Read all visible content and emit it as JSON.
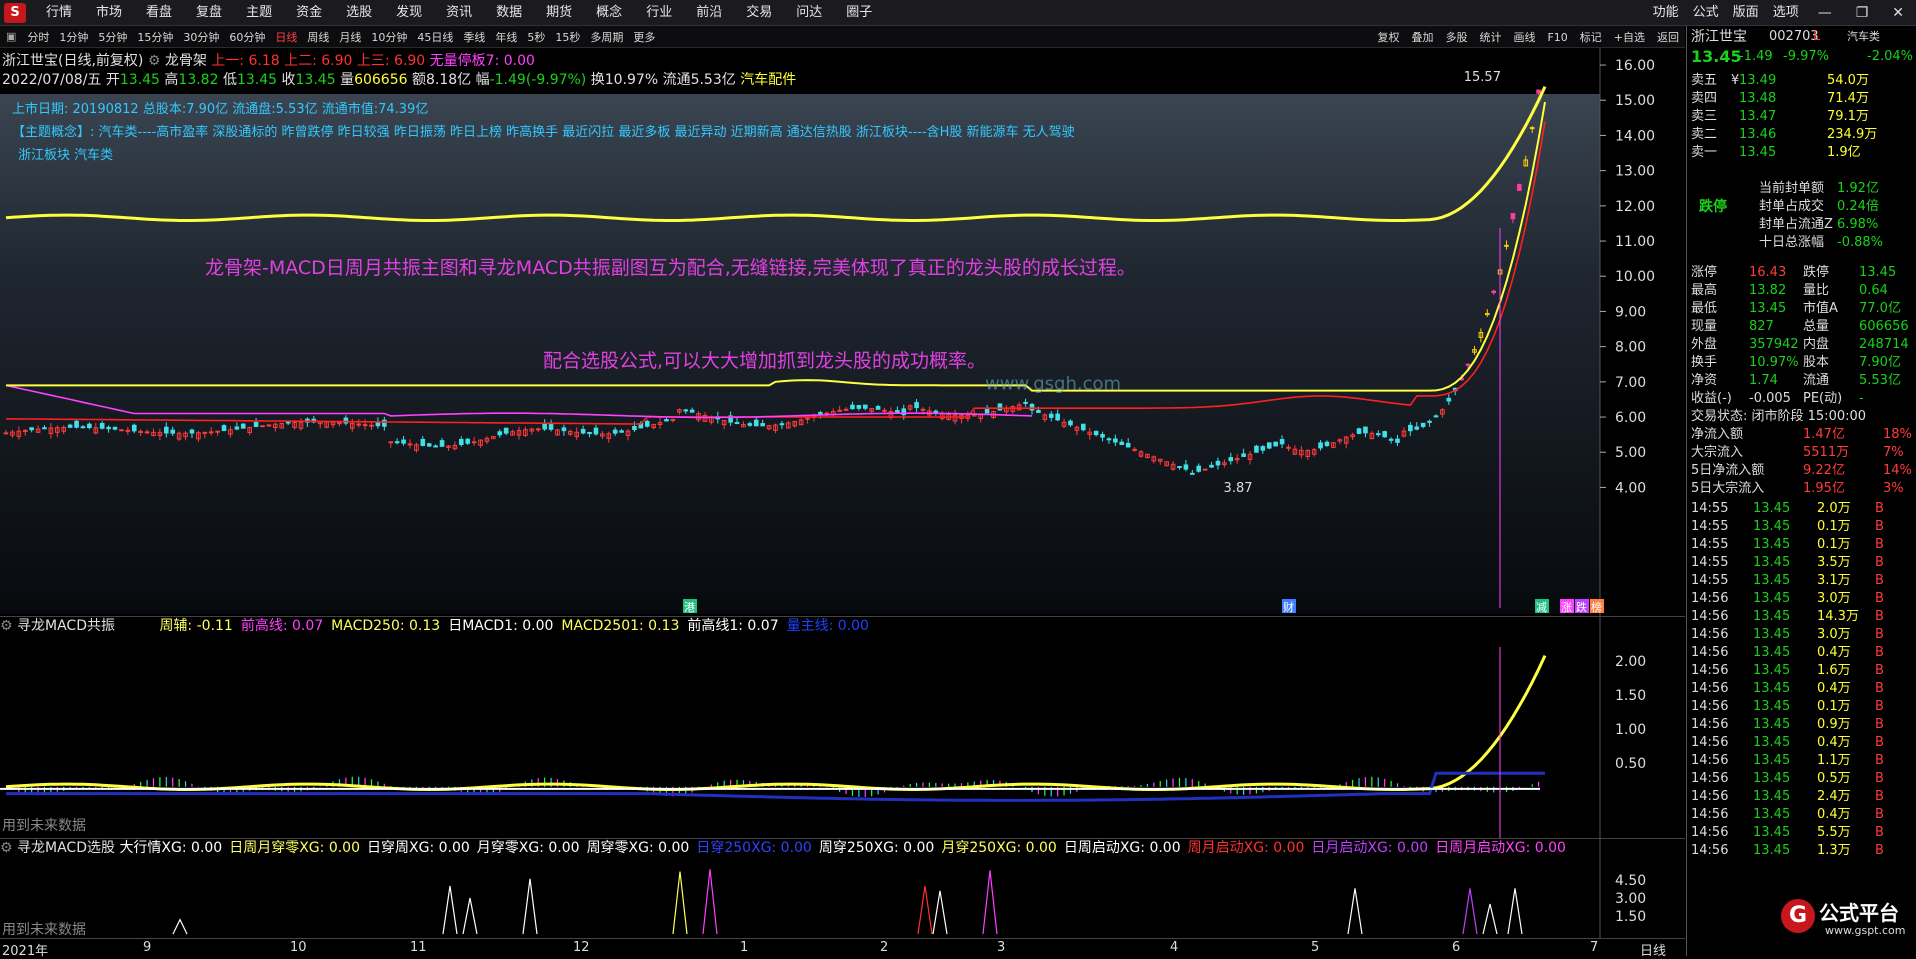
{
  "menu": {
    "logo": "S",
    "items": [
      "行情",
      "市场",
      "看盘",
      "复盘",
      "主题",
      "资金",
      "选股",
      "发现",
      "资讯",
      "数据",
      "期货",
      "概念",
      "行业",
      "前沿",
      "交易",
      "问达",
      "圈子"
    ],
    "right": [
      "功能",
      "公式",
      "版面",
      "选项"
    ],
    "win": [
      "—",
      "❐",
      "✕"
    ]
  },
  "toolbar": {
    "items": [
      "分时",
      "1分钟",
      "5分钟",
      "15分钟",
      "30分钟",
      "60分钟",
      "日线",
      "周线",
      "月线",
      "10分钟",
      "45日线",
      "季线",
      "年线",
      "5秒",
      "15秒",
      "多周期",
      "更多"
    ],
    "active": "日线",
    "right": [
      "复权",
      "叠加",
      "多股",
      "统计",
      "画线",
      "F10",
      "标记",
      "+自选",
      "返回"
    ]
  },
  "header": {
    "line1_name": "浙江世宝(日线,前复权)",
    "line1_ind": "龙骨架",
    "line1_vals": "上一: 6.18 上二: 6.90 上三: 6.90",
    "line1_extra": "无量停板7: 0.00",
    "line2_date": "2022/07/08/五",
    "line2_open_lbl": "开",
    "line2_open": "13.45",
    "line2_high_lbl": "高",
    "line2_high": "13.82",
    "line2_low_lbl": "低",
    "line2_low": "13.45",
    "line2_close_lbl": "收",
    "line2_close": "13.45",
    "line2_vol_lbl": "量",
    "line2_vol": "606656",
    "line2_amt": "额8.18亿",
    "line2_fu_lbl": "幅",
    "line2_fu": "-1.49(-9.97%)",
    "line2_huan": "换10.97%",
    "line2_ltong": "流通5.53亿",
    "line2_sector": "汽车配件"
  },
  "infopanel": {
    "row1": "上市日期: 20190812  总股本:7.90亿      流通盘:5.53亿          流通市值:74.39亿",
    "row2_label": "【主题概念】:",
    "row2": " 汽车类----高市盈率 深股通标的 昨曾跌停 昨日较强 昨日振荡 昨日上榜 昨高换手 最近闪拉 最近多板 最近异动 近期新高 通达信热股 浙江板块----含H股 新能源车 无人驾驶",
    "row3": "浙江板块 汽车类"
  },
  "captions": {
    "c1": "龙骨架-MACD日周月共振主图和寻龙MACD共振副图互为配合,无缝链接,完美体现了真正的龙头股的成长过程。",
    "c2": "配合选股公式,可以大大增加抓到龙头股的成功概率。"
  },
  "price_axis": [
    "16.00",
    "15.00",
    "14.00",
    "13.00",
    "12.00",
    "11.00",
    "10.00",
    "9.00",
    "8.00",
    "7.00",
    "6.00",
    "5.00",
    "4.00"
  ],
  "price_marks": {
    "high": "15.57",
    "low": "3.87",
    "tags": [
      "港",
      "财",
      "减",
      "涨",
      "跌",
      "榜"
    ],
    "watermark": "www.gsgh.com"
  },
  "chart_data": {
    "type": "candlestick",
    "title": "浙江世宝(日线,前复权)",
    "x_labels": [
      "2021年",
      "9",
      "10",
      "11",
      "12",
      "1",
      "2",
      "3",
      "4",
      "5",
      "6",
      "7"
    ],
    "y_range": [
      3.7,
      16.2
    ],
    "high": 15.57,
    "low": 3.87,
    "last_close": 13.45,
    "series": [
      {
        "name": "上一",
        "color": "#ff3030"
      },
      {
        "name": "上二",
        "color": "#ffff40"
      },
      {
        "name": "上三",
        "color": "#ff40ff"
      }
    ]
  },
  "sub1": {
    "title": "寻龙MACD共振",
    "items": [
      {
        "t": "周辅: -0.11",
        "c": "#ffff60"
      },
      {
        "t": "前高线: 0.07",
        "c": "#ff40ff"
      },
      {
        "t": "MACD250: 0.13",
        "c": "#ffff60"
      },
      {
        "t": "日MACD1: 0.00",
        "c": "#ffffff"
      },
      {
        "t": "MACD2501: 0.13",
        "c": "#ffff60"
      },
      {
        "t": "前高线1: 0.07",
        "c": "#ffffff"
      },
      {
        "t": "量主线: 0.00",
        "c": "#2040ff"
      }
    ],
    "axis": [
      "2.00",
      "1.50",
      "1.00",
      "0.50"
    ],
    "foot": "用到未来数据"
  },
  "sub2": {
    "title": "寻龙MACD选股",
    "items": [
      {
        "t": "大行情XG: 0.00",
        "c": "#ffffff"
      },
      {
        "t": "日周月穿零XG: 0.00",
        "c": "#ffff60"
      },
      {
        "t": "日穿周XG: 0.00",
        "c": "#ffffff"
      },
      {
        "t": "月穿零XG: 0.00",
        "c": "#ffffff"
      },
      {
        "t": "周穿零XG: 0.00",
        "c": "#ffffff"
      },
      {
        "t": "日穿250XG: 0.00",
        "c": "#3040ff"
      },
      {
        "t": "周穿250XG: 0.00",
        "c": "#ffffff"
      },
      {
        "t": "月穿250XG: 0.00",
        "c": "#ffff60"
      },
      {
        "t": "日周启动XG: 0.00",
        "c": "#ffffff"
      },
      {
        "t": "周月启动XG: 0.00",
        "c": "#ff3030"
      },
      {
        "t": "日月启动XG: 0.00",
        "c": "#c040ff"
      },
      {
        "t": "日周月启动XG: 0.00",
        "c": "#ff40ff"
      }
    ],
    "axis": [
      "4.50",
      "3.00",
      "1.50"
    ],
    "foot": "用到未来数据"
  },
  "period_label": "日线",
  "quote": {
    "name": "浙江世宝",
    "code": "002703",
    "flag": "L",
    "sector": "汽车类",
    "price": "13.45",
    "chg": "-1.49",
    "pct": "-9.97%",
    "pct2": "-2.04%",
    "asks": [
      [
        "卖五",
        "¥",
        "13.49",
        "54.0万"
      ],
      [
        "卖四",
        "",
        "13.48",
        "71.4万"
      ],
      [
        "卖三",
        "",
        "13.47",
        "79.1万"
      ],
      [
        "卖二",
        "",
        "13.46",
        "234.9万"
      ],
      [
        "卖一",
        "",
        "13.45",
        "1.9亿"
      ]
    ],
    "limit_label": "跌停",
    "seal": [
      [
        "当前封单额",
        "1.92亿"
      ],
      [
        "封单占成交",
        "0.24倍"
      ],
      [
        "封单占流通Z",
        "6.98%"
      ],
      [
        "十日总涨幅",
        "-0.88%"
      ]
    ],
    "stats": [
      [
        "涨停",
        "16.43",
        "跌停",
        "13.45"
      ],
      [
        "最高",
        "13.82",
        "量比",
        "0.64"
      ],
      [
        "最低",
        "13.45",
        "市值A",
        "77.0亿"
      ],
      [
        "现量",
        "827",
        "总量",
        "606656"
      ],
      [
        "外盘",
        "357942",
        "内盘",
        "248714"
      ],
      [
        "换手",
        "10.97%",
        "股本",
        "7.90亿"
      ],
      [
        "净资",
        "1.74",
        "流通",
        "5.53亿"
      ],
      [
        "收益(-)",
        "-0.005",
        "PE(动)",
        "-"
      ]
    ],
    "status": "交易状态: 闭市阶段 15:00:00",
    "flows": [
      [
        "净流入额",
        "1.47亿",
        "18%"
      ],
      [
        "大宗流入",
        "5511万",
        "7%"
      ],
      [
        "5日净流入额",
        "9.22亿",
        "14%"
      ],
      [
        "5日大宗流入",
        "1.95亿",
        "3%"
      ]
    ],
    "ticks": [
      [
        "14:55",
        "13.45",
        "2.0万",
        "B"
      ],
      [
        "14:55",
        "13.45",
        "0.1万",
        "B"
      ],
      [
        "14:55",
        "13.45",
        "0.1万",
        "B"
      ],
      [
        "14:55",
        "13.45",
        "3.5万",
        "B"
      ],
      [
        "14:55",
        "13.45",
        "3.1万",
        "B"
      ],
      [
        "14:56",
        "13.45",
        "3.0万",
        "B"
      ],
      [
        "14:56",
        "13.45",
        "14.3万",
        "B"
      ],
      [
        "14:56",
        "13.45",
        "3.0万",
        "B"
      ],
      [
        "14:56",
        "13.45",
        "0.4万",
        "B"
      ],
      [
        "14:56",
        "13.45",
        "1.6万",
        "B"
      ],
      [
        "14:56",
        "13.45",
        "0.4万",
        "B"
      ],
      [
        "14:56",
        "13.45",
        "0.1万",
        "B"
      ],
      [
        "14:56",
        "13.45",
        "0.9万",
        "B"
      ],
      [
        "14:56",
        "13.45",
        "0.4万",
        "B"
      ],
      [
        "14:56",
        "13.45",
        "1.1万",
        "B"
      ],
      [
        "14:56",
        "13.45",
        "0.5万",
        "B"
      ],
      [
        "14:56",
        "13.45",
        "2.4万",
        "B"
      ],
      [
        "14:56",
        "13.45",
        "0.4万",
        "B"
      ],
      [
        "14:56",
        "13.45",
        "5.5万",
        "B"
      ],
      [
        "14:56",
        "13.45",
        "1.3万",
        "B"
      ]
    ]
  },
  "brand": {
    "text": "公式平台",
    "url": "www.gspt.com",
    "logo": "G"
  }
}
